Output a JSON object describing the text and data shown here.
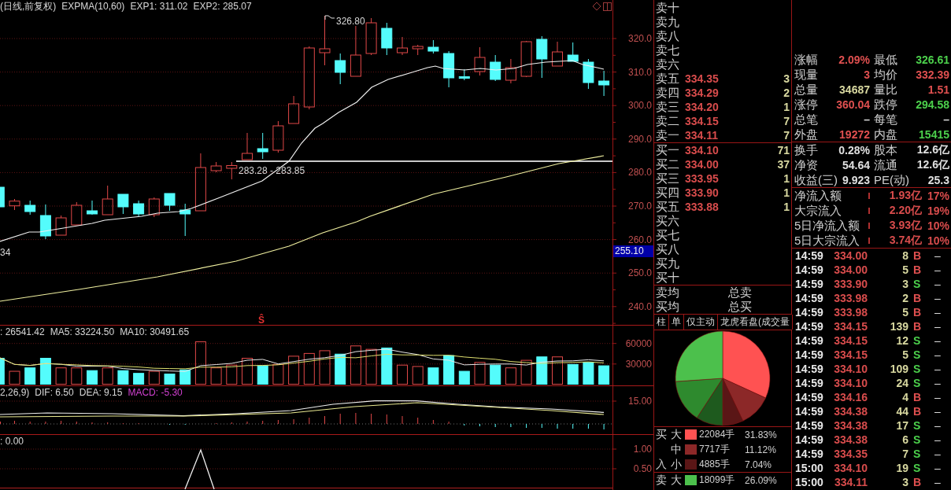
{
  "price_panel": {
    "readings": [
      "(日线,前复权)",
      "EXPMA(10,60)",
      "EXP1: 311.02",
      "EXP2: 285.07"
    ],
    "axis_labels": [
      "320.0",
      "310.0",
      "300.0",
      "290.0",
      "280.0",
      "270.0",
      "260.0",
      "250.0",
      "240.0"
    ],
    "high_label": "326.80",
    "range_label": "283.28 - 283.85",
    "edge_label": "34",
    "signal_marker": "Ŝ",
    "price_tag": "255.10"
  },
  "volume_panel": {
    "readings": [
      ": 26541.42",
      "MA5: 33224.50",
      "MA10: 30491.65"
    ],
    "axis_labels": [
      "60000",
      "30000"
    ]
  },
  "macd_panel": {
    "readings": [
      {
        "text": "2,26,9)",
        "color": "#d8d8d8"
      },
      {
        "text": "DIF: 6.50",
        "color": "#d8d8d8"
      },
      {
        "text": "DEA: 9.15",
        "color": "#d8d8d8"
      },
      {
        "text": "MACD: -5.30",
        "color": "#d040d0"
      }
    ],
    "axis_label": "15.00"
  },
  "signal_panel": {
    "reading": ": 0.00",
    "axis_labels": [
      "1.00",
      "0.50"
    ]
  },
  "order_book": {
    "asks": [
      {
        "label": "卖十"
      },
      {
        "label": "卖九"
      },
      {
        "label": "卖八"
      },
      {
        "label": "卖七"
      },
      {
        "label": "卖六"
      },
      {
        "label": "卖五",
        "price": "334.35",
        "volume": "3"
      },
      {
        "label": "卖四",
        "price": "334.29",
        "volume": "2"
      },
      {
        "label": "卖三",
        "price": "334.20",
        "volume": "1"
      },
      {
        "label": "卖二",
        "price": "334.15",
        "volume": "7"
      },
      {
        "label": "卖一",
        "price": "334.11",
        "volume": "7"
      }
    ],
    "bids": [
      {
        "label": "买一",
        "price": "334.10",
        "volume": "71"
      },
      {
        "label": "买二",
        "price": "334.00",
        "volume": "37"
      },
      {
        "label": "买三",
        "price": "333.95",
        "volume": "1"
      },
      {
        "label": "买四",
        "price": "333.90",
        "volume": "1"
      },
      {
        "label": "买五",
        "price": "333.88",
        "volume": "1"
      },
      {
        "label": "买六"
      },
      {
        "label": "买七"
      },
      {
        "label": "买八"
      },
      {
        "label": "买九"
      },
      {
        "label": "买十"
      }
    ],
    "averages": [
      {
        "label": "卖均",
        "total_label": "总卖"
      },
      {
        "label": "买均",
        "total_label": "总买"
      }
    ]
  },
  "tabs": [
    "柱",
    "单",
    "仅主动",
    "龙虎看盘(成交量"
  ],
  "money_flow": {
    "chart_data": {
      "type": "pie",
      "values": [
        31.83,
        11.12,
        7.04,
        9.2,
        14.72,
        26.09
      ]
    }
  },
  "flow_legend": [
    {
      "rows": [
        {
          "side_label": "买",
          "size": "大",
          "color": "#ff5252",
          "volume": "22084手",
          "share": "31.83%"
        },
        {
          "size": "中",
          "color": "#8c2828",
          "volume": "7717手",
          "share": "11.12%"
        },
        {
          "side_label": "入",
          "size": "小",
          "color": "#5a1616",
          "volume": "4885手",
          "share": "7.04%"
        }
      ]
    },
    {
      "rows": [
        {
          "side_label": "卖",
          "size": "大",
          "color": "#4cc04c",
          "volume": "18099手",
          "share": "26.09%"
        }
      ]
    }
  ],
  "quote_stats": [
    {
      "cells": [
        {
          "label": "涨幅",
          "value": "2.09%",
          "color": "#e05050"
        },
        {
          "label": "最低",
          "value": "326.61",
          "color": "#4cd04c"
        }
      ]
    },
    {
      "cells": [
        {
          "label": "现量",
          "value": "3",
          "color": "#e05050"
        },
        {
          "label": "均价",
          "value": "332.39",
          "color": "#e05050"
        }
      ]
    },
    {
      "cells": [
        {
          "label": "总量",
          "value": "34687",
          "color": "#d8d8a0"
        },
        {
          "label": "量比",
          "value": "1.51",
          "color": "#e05050"
        }
      ]
    },
    {
      "cells": [
        {
          "label": "涨停",
          "value": "360.04",
          "color": "#e05050"
        },
        {
          "label": "跌停",
          "value": "294.58",
          "color": "#4cd04c"
        }
      ]
    },
    {
      "cells": [
        {
          "label": "总笔",
          "value": "–",
          "color": "#d8d8d8"
        },
        {
          "label": "每笔",
          "value": "–",
          "color": "#d8d8d8"
        }
      ]
    },
    {
      "cells": [
        {
          "label": "外盘",
          "value": "19272",
          "color": "#e05050"
        },
        {
          "label": "内盘",
          "value": "15415",
          "color": "#4cd04c"
        }
      ]
    }
  ],
  "share_stats": [
    {
      "cells": [
        {
          "label": "换手",
          "value": "0.28%",
          "color": "#e0e0e0"
        },
        {
          "label": "股本",
          "value": "12.6亿",
          "color": "#e0e0e0"
        }
      ]
    },
    {
      "cells": [
        {
          "label": "净资",
          "value": "54.64",
          "color": "#e0e0e0"
        },
        {
          "label": "流通",
          "value": "12.6亿",
          "color": "#e0e0e0"
        }
      ]
    },
    {
      "cells": [
        {
          "label": "收益(三)",
          "value": "9.923",
          "color": "#e0e0e0"
        },
        {
          "label": "PE(动)",
          "value": "25.3",
          "color": "#e0e0e0"
        }
      ]
    }
  ],
  "fund_flow": [
    {
      "label": "净流入额",
      "amount": "1.93亿",
      "share": "17%"
    },
    {
      "label": "大宗流入",
      "amount": "2.20亿",
      "share": "19%"
    },
    {
      "label": "5日净流入额",
      "amount": "3.93亿",
      "share": "10%"
    },
    {
      "label": "5日大宗流入",
      "amount": "3.74亿",
      "share": "10%"
    }
  ],
  "trades": [
    {
      "time": "14:59",
      "price": "334.00",
      "volume": "8",
      "side": "B",
      "kind": "buy",
      "flag": "–"
    },
    {
      "time": "14:59",
      "price": "334.00",
      "volume": "5",
      "side": "B",
      "kind": "buy",
      "flag": "–"
    },
    {
      "time": "14:59",
      "price": "333.90",
      "volume": "3",
      "side": "S",
      "kind": "sell",
      "flag": "–"
    },
    {
      "time": "14:59",
      "price": "333.98",
      "volume": "2",
      "side": "B",
      "kind": "buy",
      "flag": "–"
    },
    {
      "time": "14:59",
      "price": "333.98",
      "volume": "5",
      "side": "B",
      "kind": "buy",
      "flag": "–"
    },
    {
      "time": "14:59",
      "price": "334.15",
      "volume": "139",
      "side": "B",
      "kind": "buy",
      "flag": "–"
    },
    {
      "time": "14:59",
      "price": "334.15",
      "volume": "12",
      "side": "S",
      "kind": "sell",
      "flag": "–"
    },
    {
      "time": "14:59",
      "price": "334.15",
      "volume": "5",
      "side": "S",
      "kind": "sell",
      "flag": "–"
    },
    {
      "time": "14:59",
      "price": "334.10",
      "volume": "109",
      "side": "S",
      "kind": "sell",
      "flag": "–"
    },
    {
      "time": "14:59",
      "price": "334.10",
      "volume": "24",
      "side": "S",
      "kind": "sell",
      "flag": "–"
    },
    {
      "time": "14:59",
      "price": "334.16",
      "volume": "4",
      "side": "B",
      "kind": "buy",
      "flag": "–"
    },
    {
      "time": "14:59",
      "price": "334.38",
      "volume": "44",
      "side": "B",
      "kind": "buy",
      "flag": "–"
    },
    {
      "time": "14:59",
      "price": "334.38",
      "volume": "17",
      "side": "S",
      "kind": "sell",
      "flag": "–"
    },
    {
      "time": "14:59",
      "price": "334.38",
      "volume": "6",
      "side": "S",
      "kind": "sell",
      "flag": "–"
    },
    {
      "time": "14:59",
      "price": "334.35",
      "volume": "7",
      "side": "S",
      "kind": "sell",
      "flag": "–"
    },
    {
      "time": "15:00",
      "price": "334.10",
      "volume": "19",
      "side": "S",
      "kind": "sell",
      "flag": "–"
    },
    {
      "time": "15:00",
      "price": "334.11",
      "volume": "3",
      "side": "B",
      "kind": "buy",
      "flag": "–"
    }
  ]
}
